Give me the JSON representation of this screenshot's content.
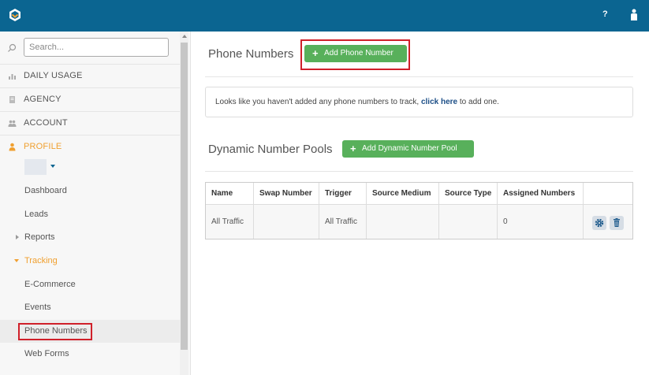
{
  "topbar": {
    "help_label": "?"
  },
  "colors": {
    "brand": "#0b6591",
    "accent": "#f0a030",
    "primary_button": "#58b05b",
    "link": "#1d4f87",
    "highlight": "#d0202a"
  },
  "icons": {
    "logo": "logo-icon",
    "help": "help-icon",
    "user": "user-icon",
    "search": "search-icon",
    "daily_usage": "chart-icon",
    "agency": "document-icon",
    "account": "group-icon",
    "profile": "user-icon",
    "settings": "gear-icon",
    "delete": "trash-icon"
  },
  "sidebar": {
    "search_placeholder": "Search...",
    "nav": [
      {
        "label": "DAILY USAGE"
      },
      {
        "label": "AGENCY"
      },
      {
        "label": "ACCOUNT"
      },
      {
        "label": "PROFILE"
      }
    ],
    "sub": [
      {
        "label": "Dashboard"
      },
      {
        "label": "Leads"
      },
      {
        "label": "Reports"
      },
      {
        "label": "Tracking"
      },
      {
        "label": "E-Commerce"
      },
      {
        "label": "Events"
      },
      {
        "label": "Phone Numbers"
      },
      {
        "label": "Web Forms"
      }
    ]
  },
  "main": {
    "phone_title": "Phone Numbers",
    "add_phone_label": "Add Phone Number",
    "notice": {
      "before": "Looks like you haven't added any phone numbers to track, ",
      "link": "click here",
      "after": " to add one."
    },
    "pools_title": "Dynamic Number Pools",
    "add_pool_label": "Add Dynamic Number Pool",
    "table": {
      "headers": [
        "Name",
        "Swap Number",
        "Trigger",
        "Source Medium",
        "Source Type",
        "Assigned Numbers",
        ""
      ],
      "rows": [
        {
          "cells": [
            "All Traffic",
            "",
            "All Traffic",
            "",
            "",
            "0"
          ]
        }
      ]
    }
  }
}
